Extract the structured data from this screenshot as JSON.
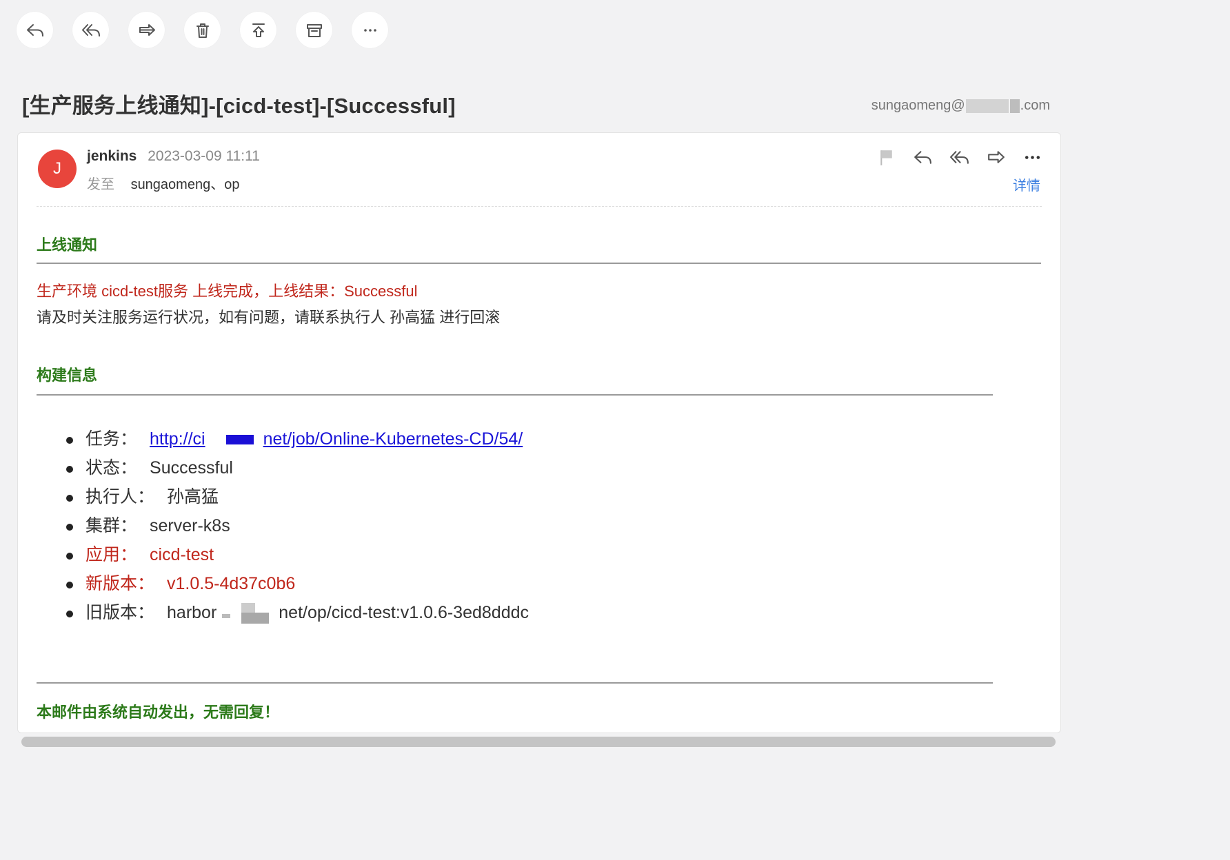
{
  "toolbar": {
    "buttons": [
      {
        "name": "reply-icon"
      },
      {
        "name": "reply-all-icon"
      },
      {
        "name": "forward-icon"
      },
      {
        "name": "trash-icon"
      },
      {
        "name": "move-icon"
      },
      {
        "name": "archive-icon"
      },
      {
        "name": "more-icon"
      }
    ]
  },
  "subject": "[生产服务上线通知]-[cicd-test]-[Successful]",
  "account": {
    "prefix": "sungaomeng@",
    "suffix": ".com"
  },
  "message": {
    "avatar_letter": "J",
    "sender": "jenkins",
    "date": "2023-03-09 11:11",
    "to_label": "发至",
    "recipients": "sungaomeng、op",
    "detail_label": "详情",
    "avatar_color": "#e8453c"
  },
  "body": {
    "section1_title": "上线通知",
    "result_line": "生产环境 cicd-test服务 上线完成，上线结果：Successful",
    "notice_line": "请及时关注服务运行状况，如有问题，请联系执行人 孙高猛 进行回滚",
    "section2_title": "构建信息",
    "build": {
      "task_label": "任务：",
      "task_link_start": "http://ci",
      "task_link_end": "net/job/Online-Kubernetes-CD/54/",
      "status_label": "状态：",
      "status_value": "Successful",
      "executor_label": "执行人：",
      "executor_value": "孙高猛",
      "cluster_label": "集群：",
      "cluster_value": "server-k8s",
      "app_label": "应用：",
      "app_value": "cicd-test",
      "new_version_label": "新版本：",
      "new_version_value": "v1.0.5-4d37c0b6",
      "old_version_label": "旧版本：",
      "old_version_start": "harbor",
      "old_version_end": "net/op/cicd-test:v1.0.6-3ed8dddc"
    },
    "footer_note": "本邮件由系统自动发出，无需回复！"
  },
  "colors": {
    "green_heading": "#2c7a1a",
    "red_text": "#c0271c",
    "link": "#1a14d8",
    "detail_link": "#3a7ee0"
  }
}
